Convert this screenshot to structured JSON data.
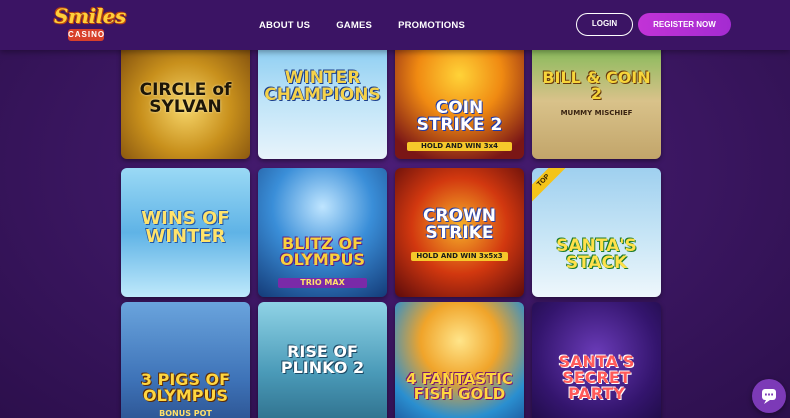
{
  "brand": {
    "logo_top": "Smiles",
    "logo_bottom": "CASINO"
  },
  "nav": [
    {
      "label": "ABOUT US"
    },
    {
      "label": "GAMES"
    },
    {
      "label": "PROMOTIONS"
    }
  ],
  "auth": {
    "login": "LOGIN",
    "register": "REGISTER NOW"
  },
  "games": [
    {
      "title": "CIRCLE of SYLVAN",
      "subtitle": ""
    },
    {
      "title": "WINTER CHAMPIONS",
      "subtitle": ""
    },
    {
      "title": "COIN STRIKE 2",
      "subtitle": "HOLD AND WIN 3x4"
    },
    {
      "title": "BILL & COIN 2",
      "subtitle": "MUMMY MISCHIEF"
    },
    {
      "title": "WINS OF WINTER",
      "subtitle": ""
    },
    {
      "title": "BLITZ OF OLYMPUS",
      "subtitle": "TRIO MAX"
    },
    {
      "title": "CROWN STRIKE",
      "subtitle": "HOLD AND WIN 3x5x3"
    },
    {
      "title": "SANTA'S STACK",
      "subtitle": "",
      "badge": "TOP"
    },
    {
      "title": "3 PIGS OF OLYMPUS",
      "subtitle": "BONUS POT"
    },
    {
      "title": "RISE OF PLINKO 2",
      "subtitle": ""
    },
    {
      "title": "4 FANTASTIC FISH GOLD",
      "subtitle": ""
    },
    {
      "title": "SANTA'S SECRET PARTY",
      "subtitle": ""
    }
  ],
  "colors": {
    "background": "#3a1660",
    "header": "#3b1464",
    "register": "#c233d6",
    "chat": "#7c3ab7"
  },
  "icons": {
    "chat": "chat-bubble-icon"
  }
}
